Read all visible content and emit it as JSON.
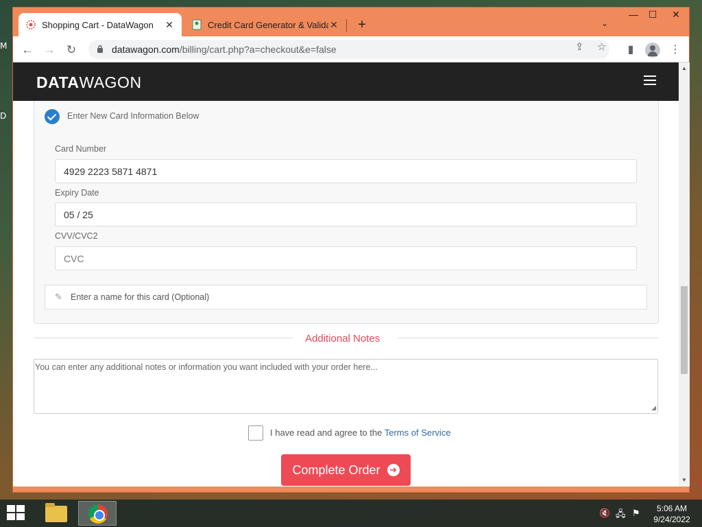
{
  "desktop": {
    "edge_letters": [
      "M",
      "D"
    ]
  },
  "browser": {
    "tabs": [
      {
        "title": "Shopping Cart - DataWagon",
        "active": true
      },
      {
        "title": "Credit Card Generator & Validator",
        "active": false
      }
    ],
    "url_domain": "datawagon.com",
    "url_path": "/billing/cart.php?a=checkout&e=false"
  },
  "site": {
    "logo_bold": "DATA",
    "logo_light": "WAGON"
  },
  "form": {
    "new_card_option": "Enter New Card Information Below",
    "card_number_label": "Card Number",
    "card_number_value": "4929 2223 5871 4871",
    "expiry_label": "Expiry Date",
    "expiry_value": "05 / 25",
    "cvv_label": "CVV/CVC2",
    "cvv_placeholder": "CVC",
    "card_name_placeholder": "Enter a name for this card (Optional)",
    "notes_title": "Additional Notes",
    "notes_placeholder": "You can enter any additional notes or information you want included with your order here...",
    "tos_text": "I have read and agree to the",
    "tos_link": "Terms of Service",
    "submit_label": "Complete Order"
  },
  "taskbar": {
    "time": "5:06 AM",
    "date": "9/24/2022"
  },
  "colors": {
    "accent_red": "#ee4a55",
    "check_blue": "#2a7fc9",
    "chrome_frame": "#f08a5b"
  }
}
